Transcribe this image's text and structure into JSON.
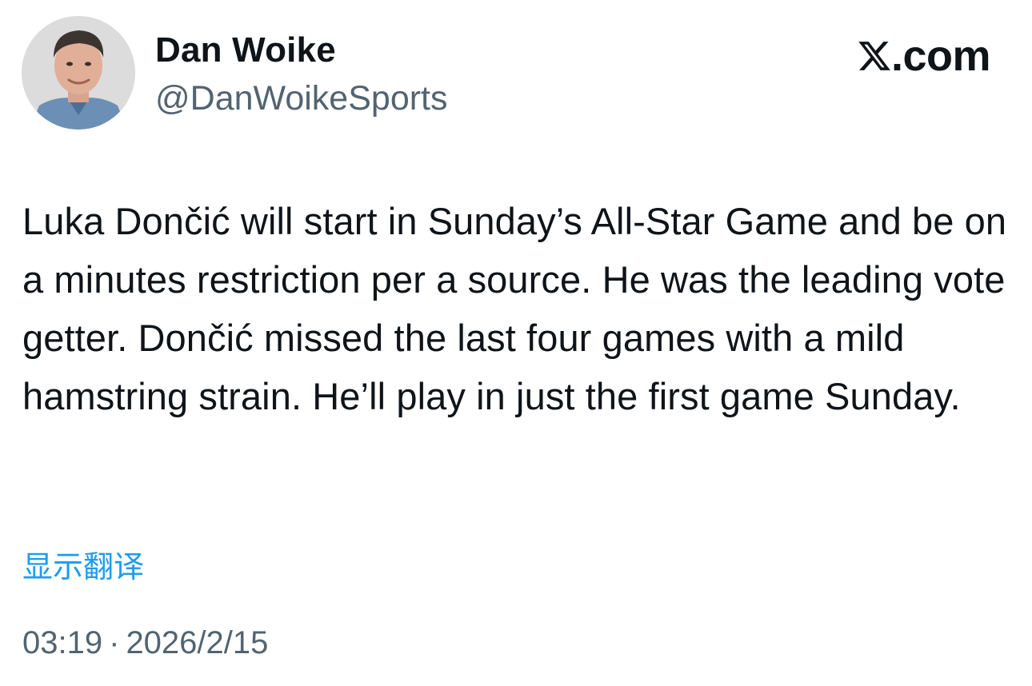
{
  "author": {
    "name": "Dan Woike",
    "handle": "@DanWoikeSports"
  },
  "brand": {
    "logo_icon": "x-logo-icon",
    "domain_suffix": ".com"
  },
  "tweet": {
    "text": "Luka Dončić will start in Sunday’s All-Star Game and be on a minutes restriction per a source. He was the leading vote getter. Dončić missed the last four games with a mild hamstring strain. He’ll play in just the first game Sunday.",
    "translate_label": "显示翻译",
    "time": "03:19",
    "separator": "·",
    "date": "2026/2/15"
  },
  "colors": {
    "text_primary": "#0f1419",
    "text_secondary": "#536471",
    "link": "#1d9bf0"
  }
}
